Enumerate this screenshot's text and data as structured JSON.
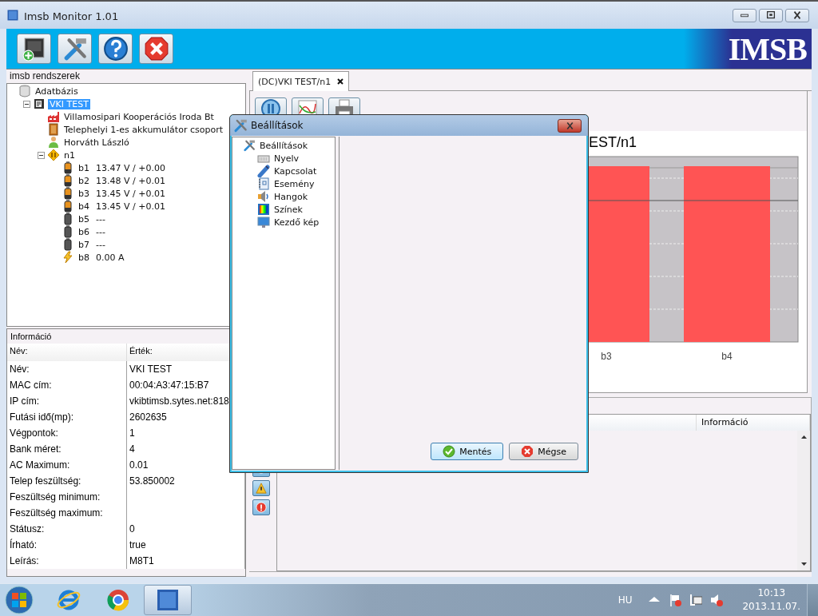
{
  "window": {
    "title": "Imsb Monitor 1.01",
    "controls": [
      {
        "kind": "minimize"
      },
      {
        "kind": "maximize"
      },
      {
        "kind": "close"
      }
    ]
  },
  "toolbar": {
    "buttons": [
      {
        "kind": "add_device"
      },
      {
        "kind": "tools"
      },
      {
        "kind": "help"
      },
      {
        "kind": "exit"
      }
    ],
    "logo": "IMSB"
  },
  "systems_panel": {
    "title": "imsb rendszerek",
    "tree": [
      {
        "label": "Adatbázis",
        "kind": "database",
        "selected": false,
        "children": [
          {
            "label": "VKI TEST",
            "kind": "device",
            "selected": true,
            "expanded": true,
            "children": [
              {
                "label": "Villamosipari Kooperációs Iroda Bt",
                "kind": "factory",
                "selected": false
              },
              {
                "label": "Telephelyi 1-es akkumulátor csoport",
                "kind": "door",
                "selected": false
              },
              {
                "label": "Horváth László",
                "kind": "person",
                "selected": false
              },
              {
                "label": "n1",
                "kind": "junction",
                "selected": false,
                "expanded": true,
                "children": [
                  {
                    "label": "b1",
                    "reading": "13.47 V / +0.00",
                    "kind": "battery",
                    "selected": false
                  },
                  {
                    "label": "b2",
                    "reading": "13.48 V / +0.01",
                    "kind": "battery",
                    "selected": false
                  },
                  {
                    "label": "b3",
                    "reading": "13.45 V / +0.01",
                    "kind": "battery",
                    "selected": false
                  },
                  {
                    "label": "b4",
                    "reading": "13.45 V / +0.01",
                    "kind": "battery",
                    "selected": false
                  },
                  {
                    "label": "b5",
                    "reading": "---",
                    "kind": "battery_off",
                    "selected": false
                  },
                  {
                    "label": "b6",
                    "reading": "---",
                    "kind": "battery_off",
                    "selected": false
                  },
                  {
                    "label": "b7",
                    "reading": "---",
                    "kind": "battery_off",
                    "selected": false
                  },
                  {
                    "label": "b8",
                    "reading": "0.00 A",
                    "kind": "bolt",
                    "selected": false
                  }
                ]
              }
            ]
          }
        ]
      }
    ]
  },
  "info_panel": {
    "title": "Információ",
    "columns": [
      "Név:",
      "Érték:"
    ],
    "rows": [
      [
        "Név:",
        "VKI TEST"
      ],
      [
        "MAC cím:",
        "00:04:A3:47:15:B7"
      ],
      [
        "IP cím:",
        "vkibtimsb.sytes.net:818"
      ],
      [
        "Futási idő(mp):",
        "2602635"
      ],
      [
        "Végpontok:",
        "1"
      ],
      [
        "Bank méret:",
        "4"
      ],
      [
        "AC Maximum:",
        "0.01"
      ],
      [
        "Telep feszültség:",
        "53.850002"
      ],
      [
        "Feszültség minimum:",
        ""
      ],
      [
        "Feszültség maximum:",
        ""
      ],
      [
        "Státusz:",
        "0"
      ],
      [
        "Írható:",
        "true"
      ],
      [
        "Leírás:",
        "M8T1"
      ]
    ]
  },
  "tabs": [
    {
      "label": "(DC)VKI TEST/n1",
      "selected": true
    }
  ],
  "view_toolbar": {
    "buttons": [
      {
        "kind": "pause"
      },
      {
        "kind": "chart"
      },
      {
        "kind": "print"
      }
    ]
  },
  "chart": {
    "title": "EST/n1",
    "categories": [
      "b3",
      "b4"
    ]
  },
  "event_panel": {
    "filters": [
      {
        "kind": "info"
      },
      {
        "kind": "warning"
      },
      {
        "kind": "error"
      }
    ],
    "columns": [
      "Információ"
    ]
  },
  "dialog": {
    "title": "Beállítások",
    "tree": [
      {
        "label": "Beállítások",
        "kind": "tools",
        "selected": false,
        "children": [
          {
            "label": "Nyelv",
            "kind": "keyboard",
            "selected": false
          },
          {
            "label": "Kapcsolat",
            "kind": "plug",
            "selected": false
          },
          {
            "label": "Esemény",
            "kind": "notebook",
            "selected": false
          },
          {
            "label": "Hangok",
            "kind": "speaker",
            "selected": false
          },
          {
            "label": "Színek",
            "kind": "palette",
            "selected": false
          },
          {
            "label": "Kezdő kép",
            "kind": "monitor",
            "selected": false
          }
        ]
      }
    ],
    "buttons": [
      {
        "label": "Mentés",
        "kind": "ok"
      },
      {
        "label": "Mégse",
        "kind": "cancel"
      }
    ]
  },
  "taskbar": {
    "apps": [
      {
        "kind": "browser_e",
        "selected": false
      },
      {
        "kind": "browser_round",
        "selected": false
      },
      {
        "kind": "app",
        "selected": true
      }
    ],
    "language": "HU",
    "tray_icons": [
      {
        "kind": "arrow"
      },
      {
        "kind": "flag"
      },
      {
        "kind": "network"
      },
      {
        "kind": "volume"
      }
    ],
    "time": "10:13",
    "date": "2013.11.07."
  }
}
